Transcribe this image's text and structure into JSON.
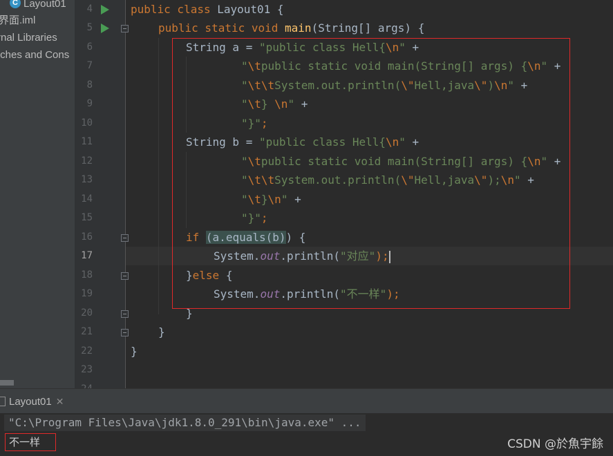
{
  "project": {
    "items": [
      {
        "label": "Layout01",
        "icon": "class-icon"
      },
      {
        "label": "界面.iml"
      },
      {
        "label": "rnal Libraries"
      },
      {
        "label": "tches and Cons"
      }
    ]
  },
  "editor": {
    "line_numbers": [
      "4",
      "5",
      "6",
      "7",
      "8",
      "9",
      "10",
      "11",
      "12",
      "13",
      "14",
      "15",
      "16",
      "17",
      "18",
      "19",
      "20",
      "21",
      "22",
      "23",
      "24"
    ],
    "current_line": "17",
    "run_gutter_lines": [
      "4",
      "5"
    ],
    "code": {
      "l4": [
        "public class ",
        "Layout01 {"
      ],
      "l5": [
        "public static void ",
        "main",
        "(String[] args) {"
      ],
      "l6": [
        "String a = ",
        "\"public class Hell{",
        "\\n",
        "\"",
        " +"
      ],
      "l7": [
        "\"",
        "\\t",
        "public static void main(String[] args) {",
        "\\n",
        "\"",
        " +"
      ],
      "l8": [
        "\"",
        "\\t\\t",
        "System.out.println(",
        "\\\"",
        "Hell,java",
        "\\\"",
        ")",
        "\\n",
        "\"",
        " +"
      ],
      "l9": [
        "\"",
        "\\t",
        "} ",
        "\\n",
        "\"",
        " +"
      ],
      "l10": [
        "\"}\"",
        ";"
      ],
      "l11": [
        "String b = ",
        "\"public class Hell{",
        "\\n",
        "\"",
        " +"
      ],
      "l12": [
        "\"",
        "\\t",
        "public static void main(String[] args) {",
        "\\n",
        "\"",
        " +"
      ],
      "l13": [
        "\"",
        "\\t\\t",
        "System.out.println(",
        "\\\"",
        "Hell,java",
        "\\\"",
        ");",
        "\\n",
        "\"",
        " +"
      ],
      "l14": [
        "\"",
        "\\t",
        "}",
        "\\n",
        "\"",
        " +"
      ],
      "l15": [
        "\"}\"",
        ";"
      ],
      "l16": [
        "if ",
        "(",
        "a.equals(b)",
        ") {"
      ],
      "l17": [
        "System.",
        "out",
        ".println(",
        "\"对应\"",
        ");"
      ],
      "l18": [
        "}",
        "else ",
        "{"
      ],
      "l19": [
        "System.",
        "out",
        ".println(",
        "\"不一样\"",
        ");"
      ],
      "l20": [
        "}"
      ],
      "l21": [
        "}"
      ],
      "l22": [
        "}"
      ]
    }
  },
  "run": {
    "tab_label": "Layout01",
    "command": "\"C:\\Program Files\\Java\\jdk1.8.0_291\\bin\\java.exe\" ...",
    "output": "不一样",
    "watermark": "CSDN @於魚宇餘"
  },
  "colors": {
    "keyword": "#cc7832",
    "string": "#6a8759",
    "method": "#ffc66d",
    "static_field": "#9876aa",
    "annotation_box": "#e02a2a"
  }
}
